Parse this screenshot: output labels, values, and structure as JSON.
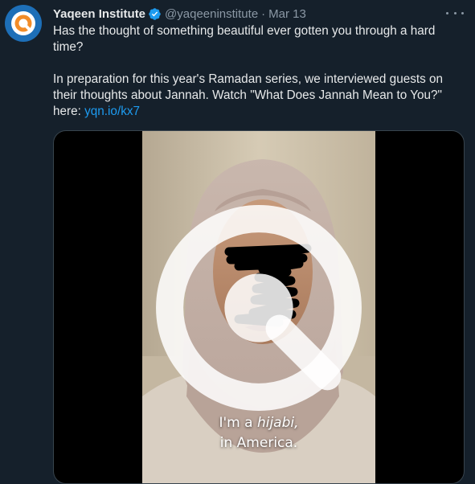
{
  "tweet": {
    "author_name": "Yaqeen Institute",
    "handle": "@yaqeeninstitute",
    "separator": "·",
    "date": "Mar 13",
    "paragraph1": "Has the thought of something beautiful ever gotten you through a hard time?",
    "paragraph2_text": "In preparation for this year's Ramadan series, we interviewed guests on their thoughts about Jannah. Watch \"What Does Jannah Mean to You?\" here: ",
    "link_text": "yqn.io/kx7"
  },
  "video": {
    "subtitle_line1_prefix": "I'm a ",
    "subtitle_line1_emphasis": "hijabi,",
    "subtitle_line2": "in America."
  },
  "icons": {
    "avatar": "yaqeen-logo-icon",
    "verified": "verified-badge-icon",
    "more": "more-options-icon",
    "watermark": "yaqeen-watermark-icon"
  },
  "colors": {
    "background": "#15202b",
    "link": "#1d9bf0",
    "verified": "#1d9bf0",
    "secondary_text": "#8b98a5",
    "brand_orange": "#f28c28",
    "brand_blue": "#1d6fb8"
  }
}
